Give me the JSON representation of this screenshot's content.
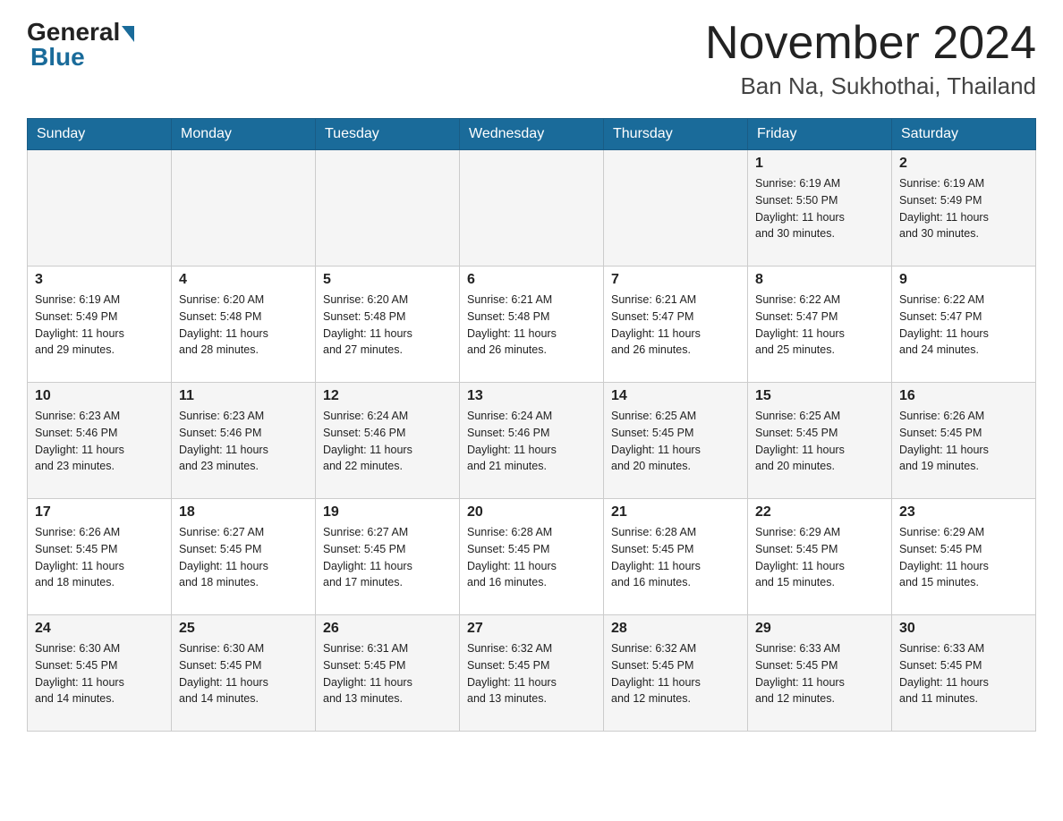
{
  "header": {
    "logo_general": "General",
    "logo_blue": "Blue",
    "title": "November 2024",
    "subtitle": "Ban Na, Sukhothai, Thailand"
  },
  "days_of_week": [
    "Sunday",
    "Monday",
    "Tuesday",
    "Wednesday",
    "Thursday",
    "Friday",
    "Saturday"
  ],
  "weeks": [
    {
      "days": [
        {
          "num": "",
          "info": ""
        },
        {
          "num": "",
          "info": ""
        },
        {
          "num": "",
          "info": ""
        },
        {
          "num": "",
          "info": ""
        },
        {
          "num": "",
          "info": ""
        },
        {
          "num": "1",
          "info": "Sunrise: 6:19 AM\nSunset: 5:50 PM\nDaylight: 11 hours\nand 30 minutes."
        },
        {
          "num": "2",
          "info": "Sunrise: 6:19 AM\nSunset: 5:49 PM\nDaylight: 11 hours\nand 30 minutes."
        }
      ]
    },
    {
      "days": [
        {
          "num": "3",
          "info": "Sunrise: 6:19 AM\nSunset: 5:49 PM\nDaylight: 11 hours\nand 29 minutes."
        },
        {
          "num": "4",
          "info": "Sunrise: 6:20 AM\nSunset: 5:48 PM\nDaylight: 11 hours\nand 28 minutes."
        },
        {
          "num": "5",
          "info": "Sunrise: 6:20 AM\nSunset: 5:48 PM\nDaylight: 11 hours\nand 27 minutes."
        },
        {
          "num": "6",
          "info": "Sunrise: 6:21 AM\nSunset: 5:48 PM\nDaylight: 11 hours\nand 26 minutes."
        },
        {
          "num": "7",
          "info": "Sunrise: 6:21 AM\nSunset: 5:47 PM\nDaylight: 11 hours\nand 26 minutes."
        },
        {
          "num": "8",
          "info": "Sunrise: 6:22 AM\nSunset: 5:47 PM\nDaylight: 11 hours\nand 25 minutes."
        },
        {
          "num": "9",
          "info": "Sunrise: 6:22 AM\nSunset: 5:47 PM\nDaylight: 11 hours\nand 24 minutes."
        }
      ]
    },
    {
      "days": [
        {
          "num": "10",
          "info": "Sunrise: 6:23 AM\nSunset: 5:46 PM\nDaylight: 11 hours\nand 23 minutes."
        },
        {
          "num": "11",
          "info": "Sunrise: 6:23 AM\nSunset: 5:46 PM\nDaylight: 11 hours\nand 23 minutes."
        },
        {
          "num": "12",
          "info": "Sunrise: 6:24 AM\nSunset: 5:46 PM\nDaylight: 11 hours\nand 22 minutes."
        },
        {
          "num": "13",
          "info": "Sunrise: 6:24 AM\nSunset: 5:46 PM\nDaylight: 11 hours\nand 21 minutes."
        },
        {
          "num": "14",
          "info": "Sunrise: 6:25 AM\nSunset: 5:45 PM\nDaylight: 11 hours\nand 20 minutes."
        },
        {
          "num": "15",
          "info": "Sunrise: 6:25 AM\nSunset: 5:45 PM\nDaylight: 11 hours\nand 20 minutes."
        },
        {
          "num": "16",
          "info": "Sunrise: 6:26 AM\nSunset: 5:45 PM\nDaylight: 11 hours\nand 19 minutes."
        }
      ]
    },
    {
      "days": [
        {
          "num": "17",
          "info": "Sunrise: 6:26 AM\nSunset: 5:45 PM\nDaylight: 11 hours\nand 18 minutes."
        },
        {
          "num": "18",
          "info": "Sunrise: 6:27 AM\nSunset: 5:45 PM\nDaylight: 11 hours\nand 18 minutes."
        },
        {
          "num": "19",
          "info": "Sunrise: 6:27 AM\nSunset: 5:45 PM\nDaylight: 11 hours\nand 17 minutes."
        },
        {
          "num": "20",
          "info": "Sunrise: 6:28 AM\nSunset: 5:45 PM\nDaylight: 11 hours\nand 16 minutes."
        },
        {
          "num": "21",
          "info": "Sunrise: 6:28 AM\nSunset: 5:45 PM\nDaylight: 11 hours\nand 16 minutes."
        },
        {
          "num": "22",
          "info": "Sunrise: 6:29 AM\nSunset: 5:45 PM\nDaylight: 11 hours\nand 15 minutes."
        },
        {
          "num": "23",
          "info": "Sunrise: 6:29 AM\nSunset: 5:45 PM\nDaylight: 11 hours\nand 15 minutes."
        }
      ]
    },
    {
      "days": [
        {
          "num": "24",
          "info": "Sunrise: 6:30 AM\nSunset: 5:45 PM\nDaylight: 11 hours\nand 14 minutes."
        },
        {
          "num": "25",
          "info": "Sunrise: 6:30 AM\nSunset: 5:45 PM\nDaylight: 11 hours\nand 14 minutes."
        },
        {
          "num": "26",
          "info": "Sunrise: 6:31 AM\nSunset: 5:45 PM\nDaylight: 11 hours\nand 13 minutes."
        },
        {
          "num": "27",
          "info": "Sunrise: 6:32 AM\nSunset: 5:45 PM\nDaylight: 11 hours\nand 13 minutes."
        },
        {
          "num": "28",
          "info": "Sunrise: 6:32 AM\nSunset: 5:45 PM\nDaylight: 11 hours\nand 12 minutes."
        },
        {
          "num": "29",
          "info": "Sunrise: 6:33 AM\nSunset: 5:45 PM\nDaylight: 11 hours\nand 12 minutes."
        },
        {
          "num": "30",
          "info": "Sunrise: 6:33 AM\nSunset: 5:45 PM\nDaylight: 11 hours\nand 11 minutes."
        }
      ]
    }
  ]
}
